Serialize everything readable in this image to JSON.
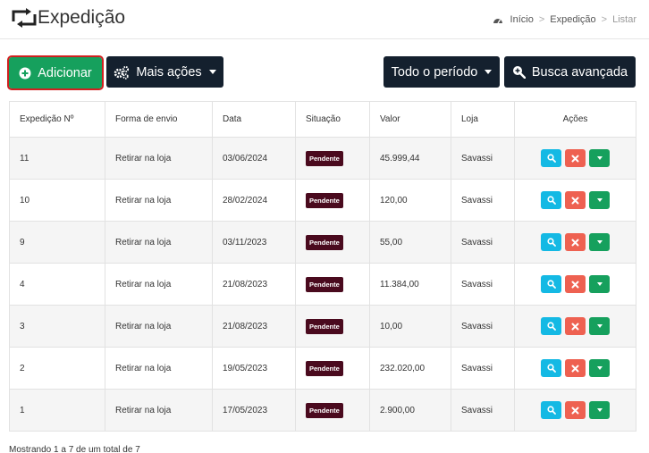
{
  "header": {
    "title": "Expedição",
    "icon": "loop-arrows-icon",
    "breadcrumb": [
      "Início",
      "Expedição",
      "Listar"
    ]
  },
  "toolbar": {
    "add_label": "Adicionar",
    "more_actions_label": "Mais ações",
    "period_label": "Todo o período",
    "advanced_search_label": "Busca avançada"
  },
  "colors": {
    "add_button": "#16a05d",
    "dark_button": "#14202e",
    "badge_pending": "#4a0a1e",
    "view_action": "#14b9e4",
    "delete_action": "#ee6151",
    "more_action": "#16a05d",
    "highlight_outline": "#d02020"
  },
  "table": {
    "columns": [
      "Expedição Nº",
      "Forma de envio",
      "Data",
      "Situação",
      "Valor",
      "Loja",
      "Ações"
    ],
    "rows": [
      {
        "id": "11",
        "shipping": "Retirar na loja",
        "date": "03/06/2024",
        "status": "Pendente",
        "value": "45.999,44",
        "store": "Savassi"
      },
      {
        "id": "10",
        "shipping": "Retirar na loja",
        "date": "28/02/2024",
        "status": "Pendente",
        "value": "120,00",
        "store": "Savassi"
      },
      {
        "id": "9",
        "shipping": "Retirar na loja",
        "date": "03/11/2023",
        "status": "Pendente",
        "value": "55,00",
        "store": "Savassi"
      },
      {
        "id": "4",
        "shipping": "Retirar na loja",
        "date": "21/08/2023",
        "status": "Pendente",
        "value": "11.384,00",
        "store": "Savassi"
      },
      {
        "id": "3",
        "shipping": "Retirar na loja",
        "date": "21/08/2023",
        "status": "Pendente",
        "value": "10,00",
        "store": "Savassi"
      },
      {
        "id": "2",
        "shipping": "Retirar na loja",
        "date": "19/05/2023",
        "status": "Pendente",
        "value": "232.020,00",
        "store": "Savassi"
      },
      {
        "id": "1",
        "shipping": "Retirar na loja",
        "date": "17/05/2023",
        "status": "Pendente",
        "value": "2.900,00",
        "store": "Savassi"
      }
    ]
  },
  "footer": {
    "summary": "Mostrando 1 a 7 de um total de 7"
  }
}
